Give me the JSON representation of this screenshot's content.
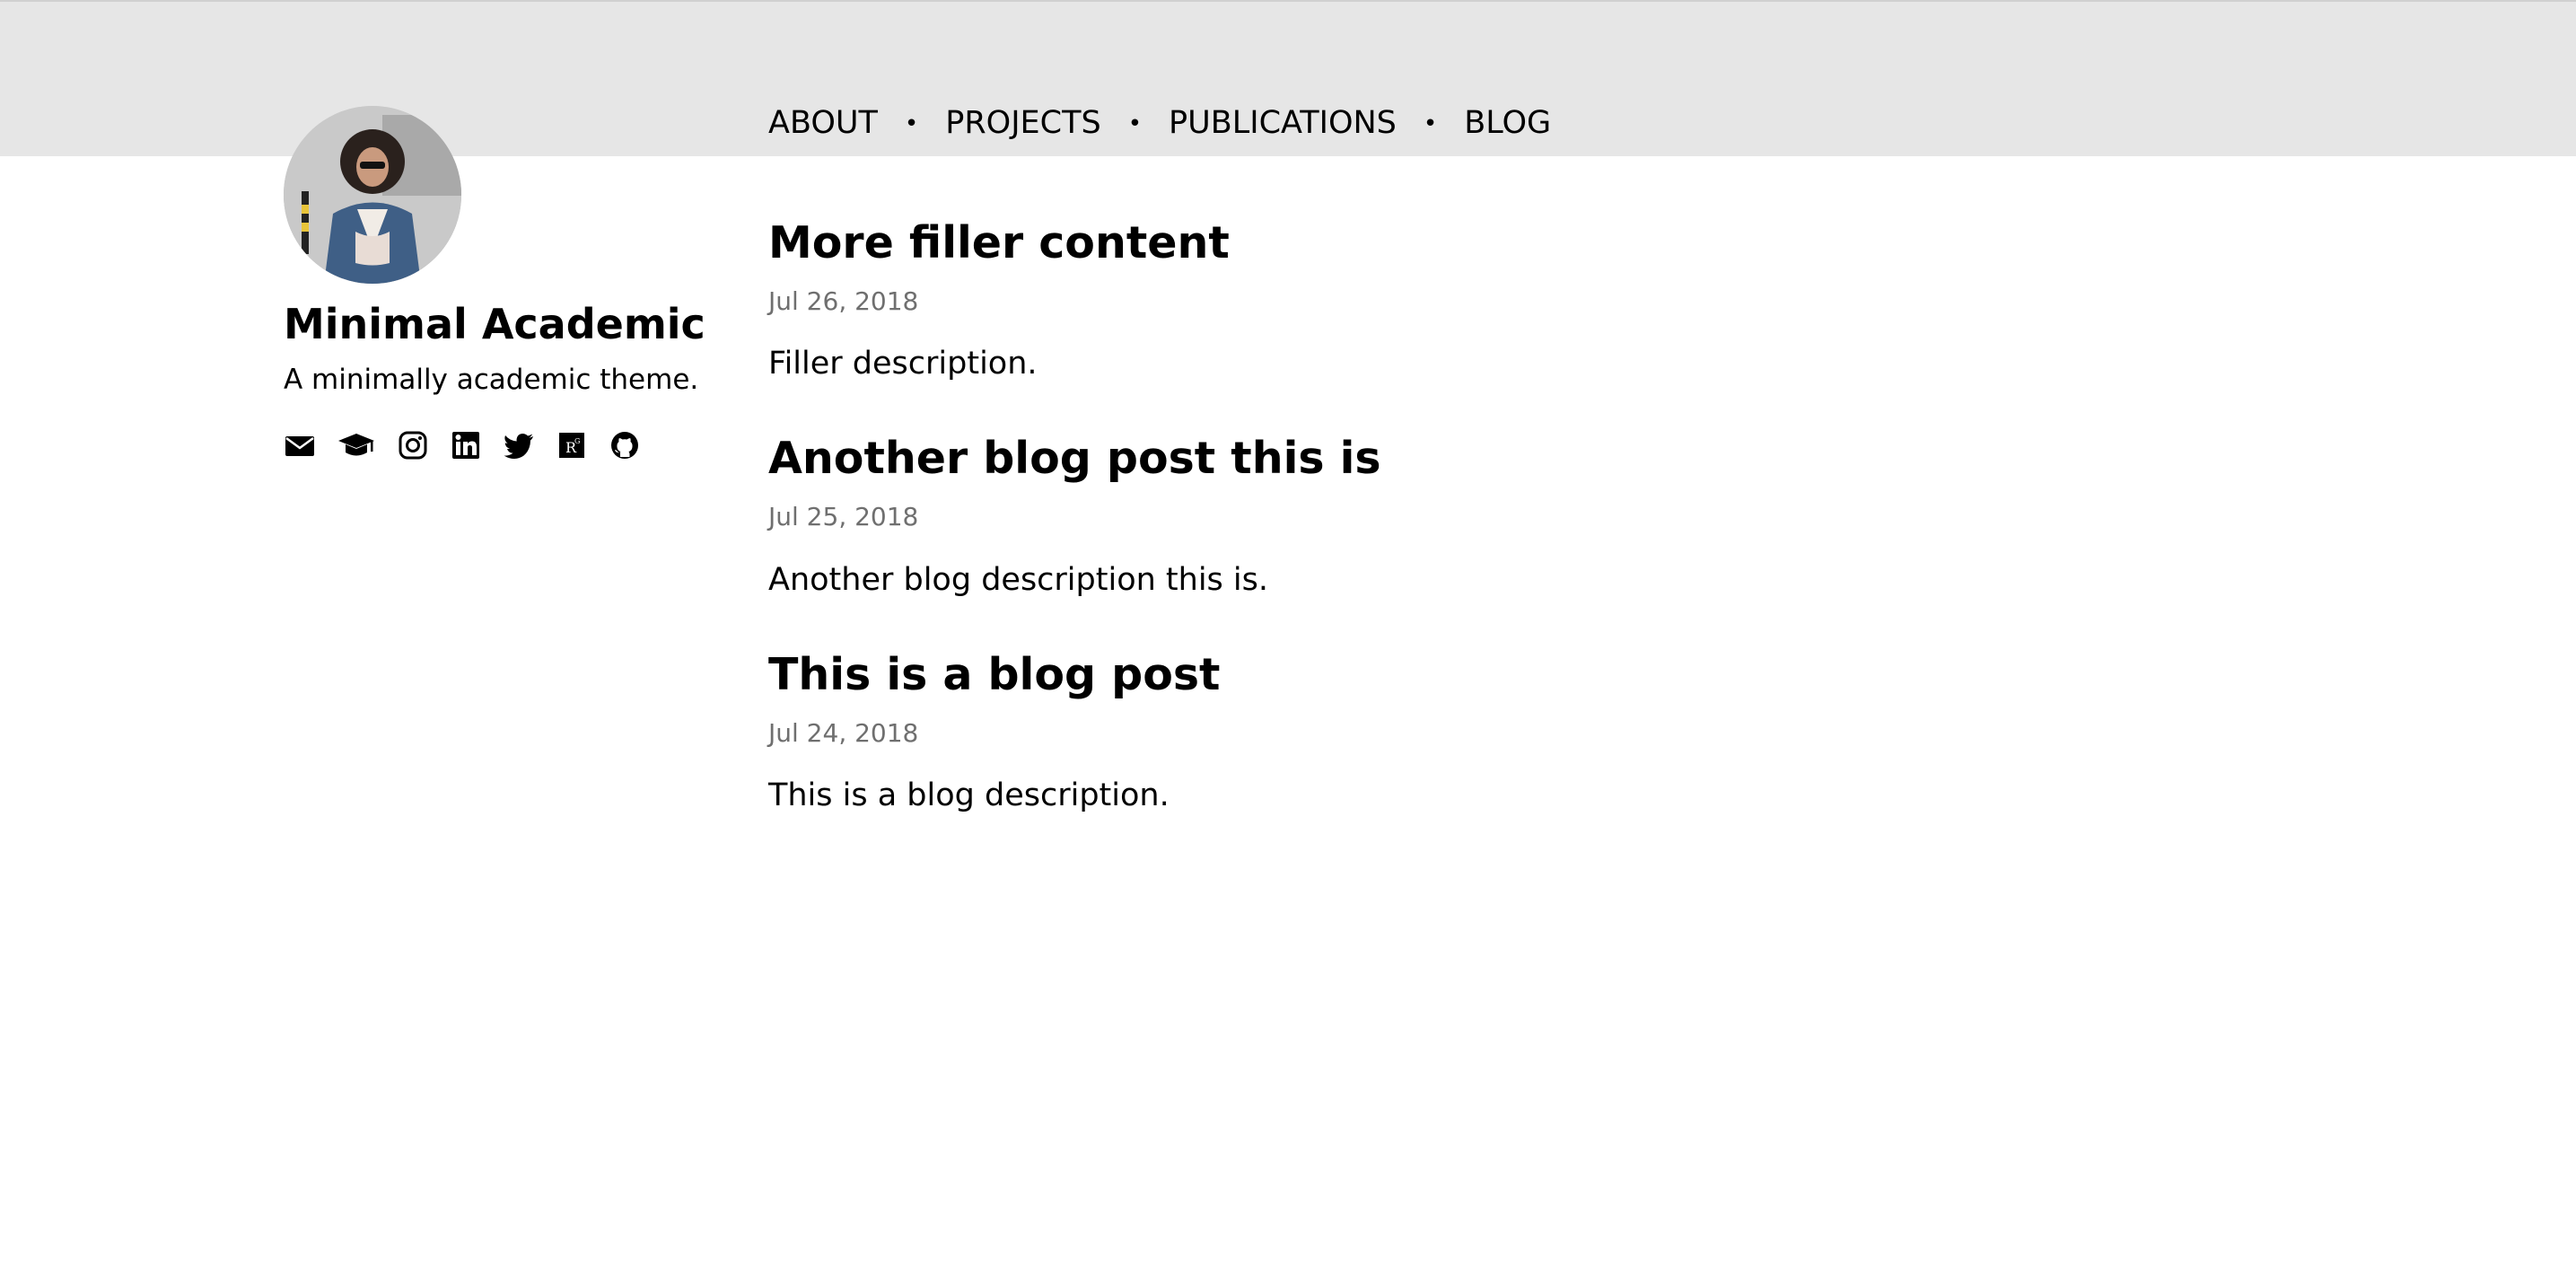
{
  "site": {
    "title": "Minimal Academic",
    "description": "A minimally academic theme."
  },
  "social": [
    {
      "name": "email-icon"
    },
    {
      "name": "graduation-cap-icon"
    },
    {
      "name": "instagram-icon"
    },
    {
      "name": "linkedin-icon"
    },
    {
      "name": "twitter-icon"
    },
    {
      "name": "researchgate-icon"
    },
    {
      "name": "github-icon"
    }
  ],
  "nav": {
    "items": [
      "ABOUT",
      "PROJECTS",
      "PUBLICATIONS",
      "BLOG"
    ],
    "separator": "•"
  },
  "posts": [
    {
      "title": "More filler content",
      "date": "Jul 26, 2018",
      "description": "Filler description."
    },
    {
      "title": "Another blog post this is",
      "date": "Jul 25, 2018",
      "description": "Another blog description this is."
    },
    {
      "title": "This is a blog post",
      "date": "Jul 24, 2018",
      "description": "This is a blog description."
    }
  ],
  "colors": {
    "header_band": "#e6e6e6",
    "date_text": "#6f6f6f",
    "text": "#000000"
  }
}
